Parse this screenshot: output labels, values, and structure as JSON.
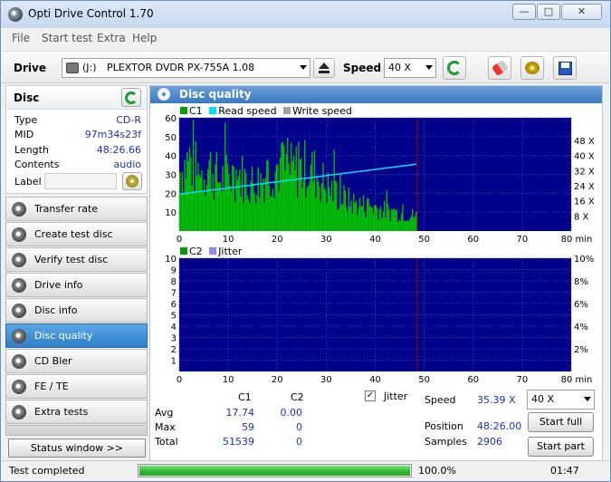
{
  "window": {
    "title": "Opti Drive Control 1.70",
    "controls": [
      "—",
      "□",
      "✕"
    ]
  },
  "menu": [
    "File",
    "Start test",
    "Extra",
    "Help"
  ],
  "toolbar": {
    "drive_label": "Drive",
    "drive_letter": "(J:)",
    "drive_name": "PLEXTOR DVDR   PX-755A 1.08",
    "speed_label": "Speed",
    "speed_value": "40 X"
  },
  "disc": {
    "heading": "Disc",
    "fields": [
      {
        "key": "Type",
        "value": "CD-R"
      },
      {
        "key": "MID",
        "value": "97m34s23f"
      },
      {
        "key": "Length",
        "value": "48:26.66"
      },
      {
        "key": "Contents",
        "value": "audio"
      }
    ],
    "label_key": "Label",
    "label_value": ""
  },
  "nav": [
    {
      "label": "Transfer rate",
      "active": false
    },
    {
      "label": "Create test disc",
      "active": false
    },
    {
      "label": "Verify test disc",
      "active": false
    },
    {
      "label": "Drive info",
      "active": false
    },
    {
      "label": "Disc info",
      "active": false
    },
    {
      "label": "Disc quality",
      "active": true
    },
    {
      "label": "CD Bler",
      "active": false
    },
    {
      "label": "FE / TE",
      "active": false
    },
    {
      "label": "Extra tests",
      "active": false
    }
  ],
  "status_window_label": "Status window >>",
  "panel_title": "Disc quality",
  "chart_data": [
    {
      "type": "bar",
      "legend": [
        "C1",
        "Read speed",
        "Write speed"
      ],
      "x_ticks": [
        "0",
        "10",
        "20",
        "30",
        "40",
        "50",
        "60",
        "70",
        "80 min"
      ],
      "y_ticks": [
        "60",
        "50",
        "40",
        "30",
        "20",
        "10"
      ],
      "y2_ticks": [
        "48 X",
        "40 X",
        "32 X",
        "24 X",
        "16 X",
        "8 X"
      ],
      "xlim": [
        0,
        80
      ],
      "ylim": [
        0,
        60
      ],
      "y2lim": [
        0,
        48
      ],
      "data_end_min": 48.4,
      "read_speed": {
        "x": [
          0,
          48.4
        ],
        "y": [
          19.5,
          35.4
        ]
      },
      "c1_approx": {
        "x": [
          0,
          2,
          4,
          6,
          8,
          10,
          12,
          14,
          16,
          18,
          20,
          22,
          24,
          26,
          28,
          30,
          32,
          34,
          36,
          38,
          40,
          42,
          44,
          46,
          48
        ],
        "y": [
          35,
          42,
          33,
          38,
          30,
          32,
          34,
          28,
          29,
          34,
          38,
          35,
          36,
          37,
          33,
          26,
          22,
          18,
          16,
          15,
          14,
          12,
          11,
          10,
          9
        ]
      },
      "colors": {
        "c1": "#00c000",
        "read_speed": "#00e0ff",
        "write_speed": "#a0a0a0",
        "bg": "#00008b",
        "marker": "#b00000"
      }
    },
    {
      "type": "bar",
      "legend": [
        "C2",
        "Jitter"
      ],
      "x_ticks": [
        "0",
        "10",
        "20",
        "30",
        "40",
        "50",
        "60",
        "70",
        "80 min"
      ],
      "y_ticks": [
        "10",
        "9",
        "8",
        "7",
        "6",
        "5",
        "4",
        "3",
        "2",
        "1"
      ],
      "y2_ticks": [
        "10%",
        "8%",
        "6%",
        "4%",
        "2%"
      ],
      "xlim": [
        0,
        80
      ],
      "ylim": [
        0,
        10
      ],
      "values": [],
      "colors": {
        "c2": "#00a000",
        "jitter": "#8888ff",
        "bg": "#00008b",
        "marker": "#b00000"
      }
    }
  ],
  "stats": {
    "col_c1": "C1",
    "col_c2": "C2",
    "rows": [
      {
        "label": "Avg",
        "c1": "17.74",
        "c2": "0.00"
      },
      {
        "label": "Max",
        "c1": "59",
        "c2": "0"
      },
      {
        "label": "Total",
        "c1": "51539",
        "c2": "0"
      }
    ],
    "jitter_label": "Jitter",
    "jitter_checked": true,
    "speed_label": "Speed",
    "speed_value": "35.39 X",
    "speed_select": "40 X",
    "position_label": "Position",
    "position_value": "48:26.00",
    "samples_label": "Samples",
    "samples_value": "2906",
    "start_full": "Start full",
    "start_part": "Start part"
  },
  "status": {
    "text": "Test completed",
    "progress": 100,
    "progress_text": "100.0%",
    "time": "01:47"
  }
}
